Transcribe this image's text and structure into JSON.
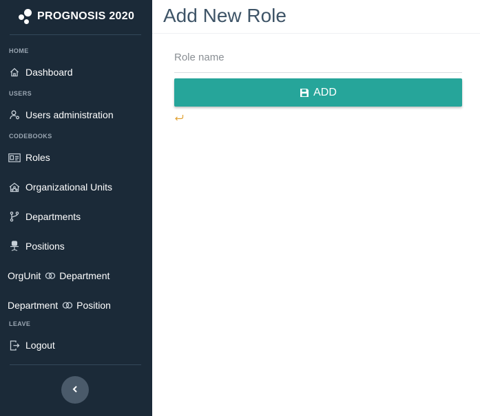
{
  "brand": {
    "title": "PROGNOSIS 2020"
  },
  "sidebar": {
    "sections": {
      "home": "HOME",
      "users": "USERS",
      "codebooks": "CODEBOOKS",
      "leave": "LEAVE"
    },
    "items": [
      {
        "label": "Dashboard",
        "icon": "home-icon"
      },
      {
        "label": "Users administration",
        "icon": "user-settings-icon"
      },
      {
        "label": "Roles",
        "icon": "id-card-icon"
      },
      {
        "label": "Organizational Units",
        "icon": "house-network-icon"
      },
      {
        "label": "Departments",
        "icon": "branch-icon"
      },
      {
        "label": "Positions",
        "icon": "office-chair-icon"
      },
      {
        "label_left": "OrgUnit",
        "label_right": "Department",
        "icon": "link-icon"
      },
      {
        "label_left": "Department",
        "label_right": "Position",
        "icon": "link-icon"
      },
      {
        "label": "Logout",
        "icon": "logout-icon"
      }
    ],
    "collapse_icon": "chevron-left-icon"
  },
  "main": {
    "title": "Add New Role",
    "form": {
      "role_name_placeholder": "Role name",
      "role_name_value": "",
      "add_button_label": "ADD",
      "add_button_icon": "floppy-disk-icon",
      "back_icon": "return-arrow-icon"
    }
  },
  "colors": {
    "sidebar_bg": "#1b2a38",
    "accent": "#26a59a",
    "title_text": "#3e5467",
    "back_arrow": "#e0a030"
  }
}
